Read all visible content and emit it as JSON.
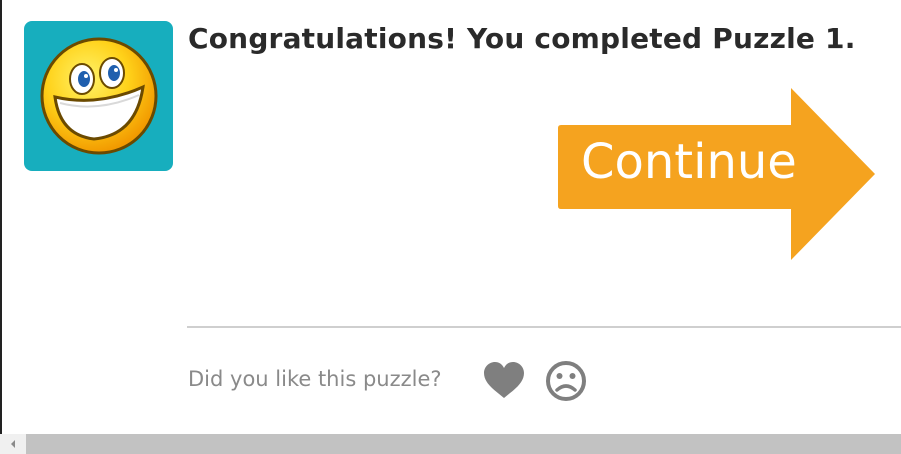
{
  "header": {
    "avatar_icon": "smiley-face-icon",
    "title": "Congratulations! You completed Puzzle 1."
  },
  "actions": {
    "continue_label": "Continue",
    "continue_color": "#f5a31f"
  },
  "feedback": {
    "question": "Did you like this puzzle?",
    "like_icon": "heart-icon",
    "dislike_icon": "sad-face-icon"
  },
  "colors": {
    "avatar_background": "#17aebe",
    "title_text": "#2a2a2a",
    "muted_text": "#8a8a8a",
    "icon_gray": "#7f7f7f"
  }
}
